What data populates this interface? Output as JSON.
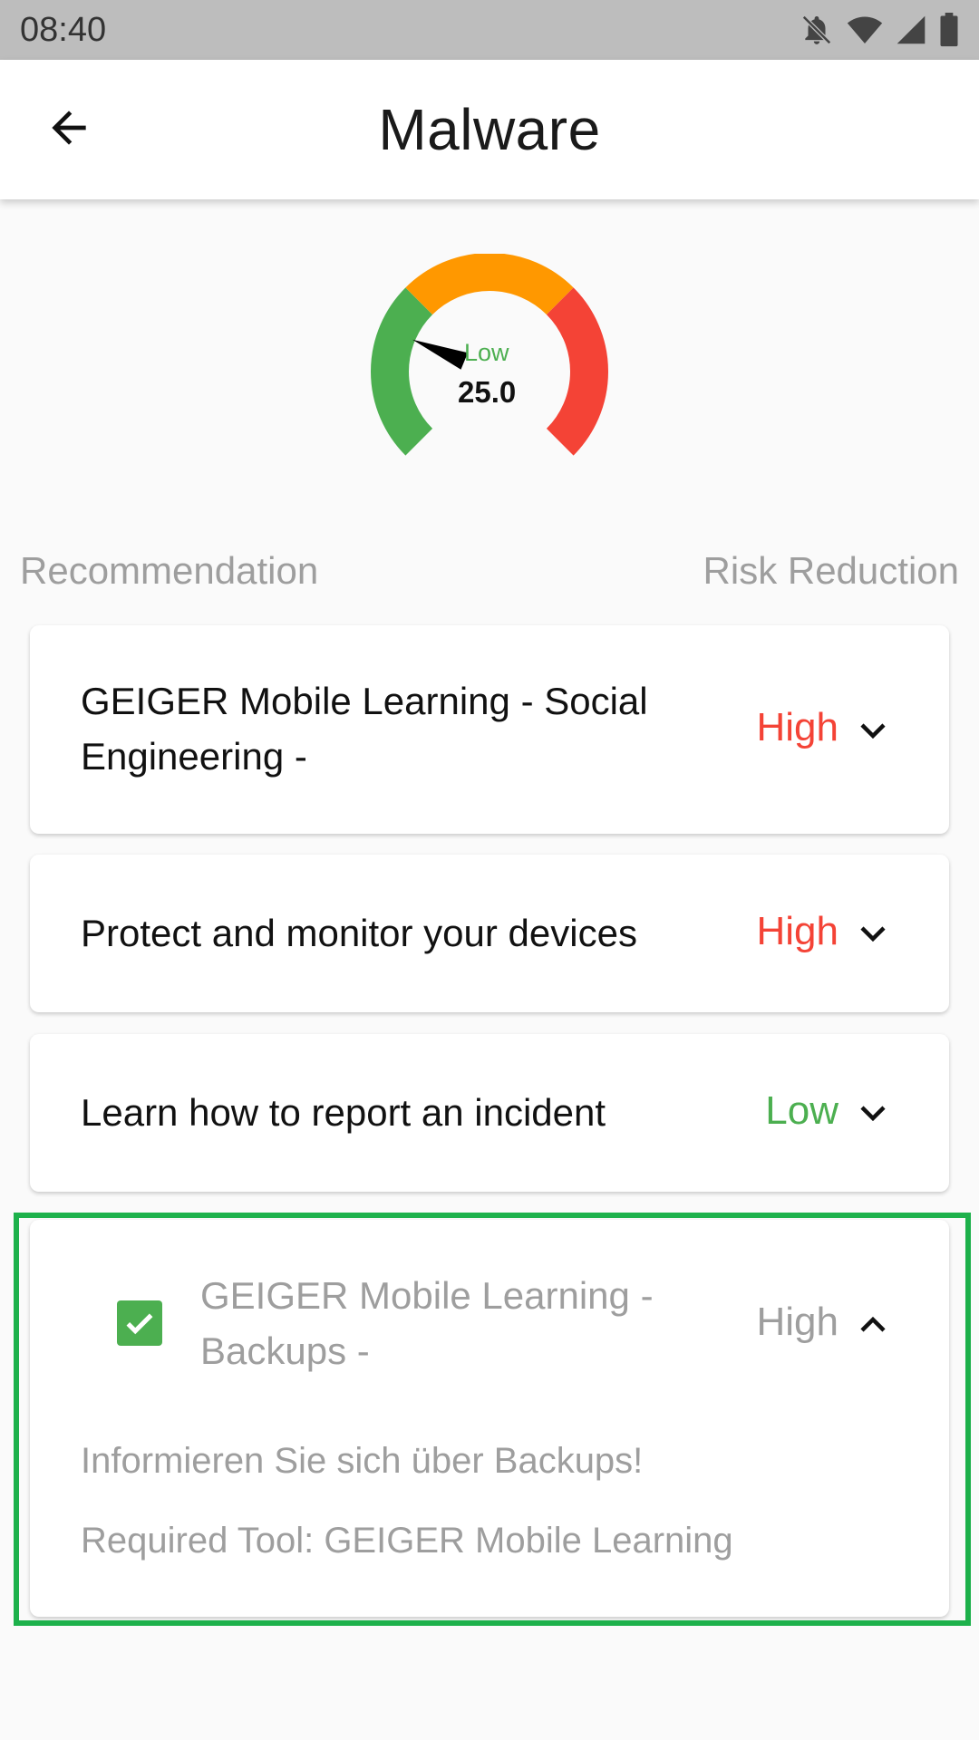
{
  "status_bar": {
    "time": "08:40",
    "icons": [
      "notifications-off-icon",
      "wifi-icon",
      "signal-icon",
      "battery-icon"
    ]
  },
  "app_bar": {
    "title": "Malware",
    "back_icon": "arrow-back-icon"
  },
  "gauge": {
    "label": "Low",
    "value": "25.0",
    "level": 25.0,
    "max": 100,
    "colors": {
      "low": "#4caf50",
      "medium": "#ff9800",
      "high": "#f44336",
      "needle": "#000000"
    }
  },
  "list_header": {
    "left": "Recommendation",
    "right": "Risk Reduction"
  },
  "recommendations": [
    {
      "title_line1": "GEIGER Mobile Learning - Social",
      "title_line2": "Engineering -",
      "risk": "High",
      "expanded": false,
      "checked": false
    },
    {
      "title": "Protect and monitor your devices",
      "risk": "High",
      "expanded": false,
      "checked": false
    },
    {
      "title": "Learn how to report an incident",
      "risk": "Low",
      "expanded": false,
      "checked": false
    },
    {
      "title_line1": "GEIGER Mobile Learning -",
      "title_line2": "Backups -",
      "risk": "High",
      "expanded": true,
      "checked": true,
      "description": "Informieren Sie sich über Backups!",
      "required_tool": "Required Tool: GEIGER Mobile Learning"
    }
  ],
  "colors": {
    "high": "#f44336",
    "low": "#4caf50",
    "muted": "#9e9e9e",
    "highlight": "#1db14b"
  }
}
